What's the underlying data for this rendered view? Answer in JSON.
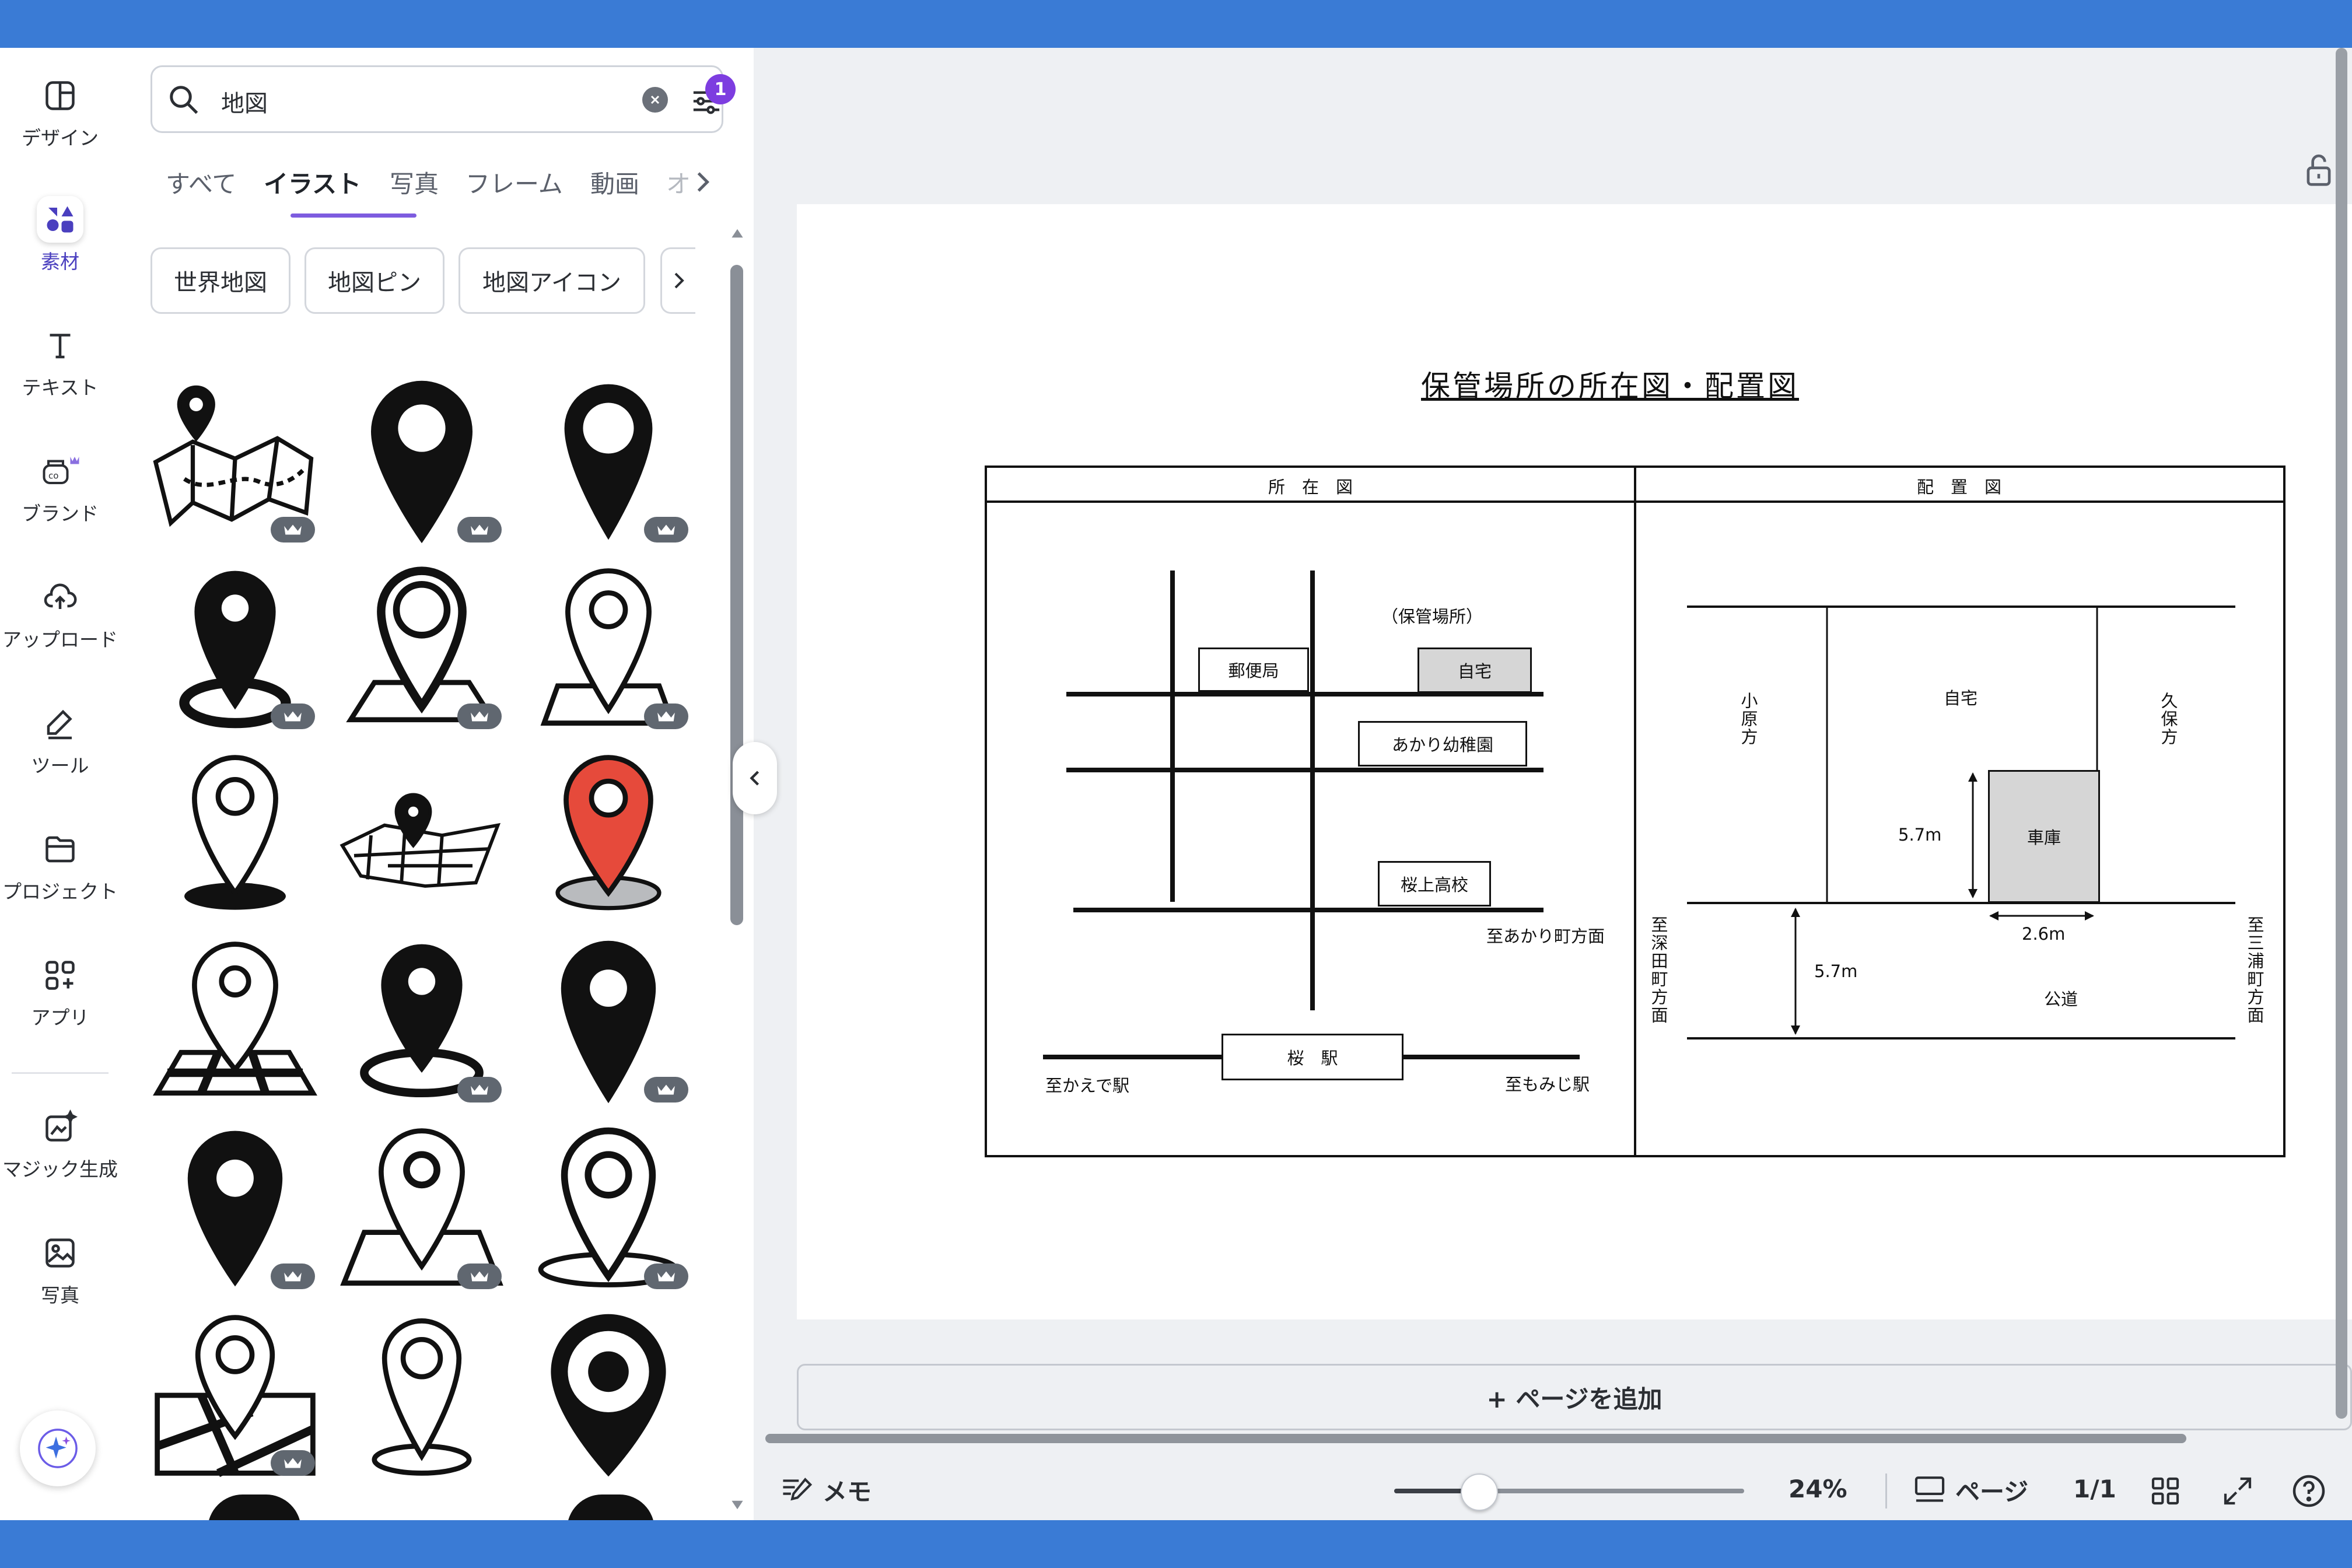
{
  "rail": {
    "items": [
      {
        "label": "デザイン",
        "icon": "layout-icon"
      },
      {
        "label": "素材",
        "icon": "elements-icon"
      },
      {
        "label": "テキスト",
        "icon": "text-icon"
      },
      {
        "label": "ブランド",
        "icon": "brand-icon"
      },
      {
        "label": "アップロード",
        "icon": "upload-icon"
      },
      {
        "label": "ツール",
        "icon": "draw-icon"
      },
      {
        "label": "プロジェクト",
        "icon": "folder-icon"
      },
      {
        "label": "アプリ",
        "icon": "apps-icon"
      },
      {
        "label": "マジック生成",
        "icon": "magic-media-icon"
      },
      {
        "label": "写真",
        "icon": "photo-icon"
      }
    ]
  },
  "search": {
    "value": "地図",
    "filter_badge": "1"
  },
  "tabs": [
    "すべて",
    "イラスト",
    "写真",
    "フレーム",
    "動画",
    "オ"
  ],
  "chips": [
    "世界地図",
    "地図ピン",
    "地図アイコン"
  ],
  "document": {
    "title": "保管場所の所在図・配置図",
    "left_header": "所　在　図",
    "right_header": "配　置　図",
    "location": {
      "storage_note": "（保管場所）",
      "post_office": "郵便局",
      "home": "自宅",
      "kindergarten": "あかり幼稚園",
      "highschool": "桜上高校",
      "station": "桜　駅",
      "to_akari": "至あかり町方面",
      "to_kaede": "至かえで駅",
      "to_momiji": "至もみじ駅"
    },
    "layout": {
      "home": "自宅",
      "garage": "車庫",
      "left_neighbor": "小原方",
      "right_neighbor": "久保方",
      "dim_vertical": "5.7m",
      "dim_width": "2.6m",
      "dim_road": "5.7m",
      "road": "公道",
      "to_left": "至深田町方面",
      "to_right": "至三浦町方面"
    }
  },
  "add_page_label": "+ ページを追加",
  "footer": {
    "notes": "メモ",
    "zoom": "24%",
    "page_label": "ページ",
    "page_count": "1/1",
    "zoom_fraction": 0.24
  },
  "colors": {
    "accent": "#7d5cdf",
    "topbar": "#3a7bd5",
    "pin_red": "#e64a3b"
  }
}
